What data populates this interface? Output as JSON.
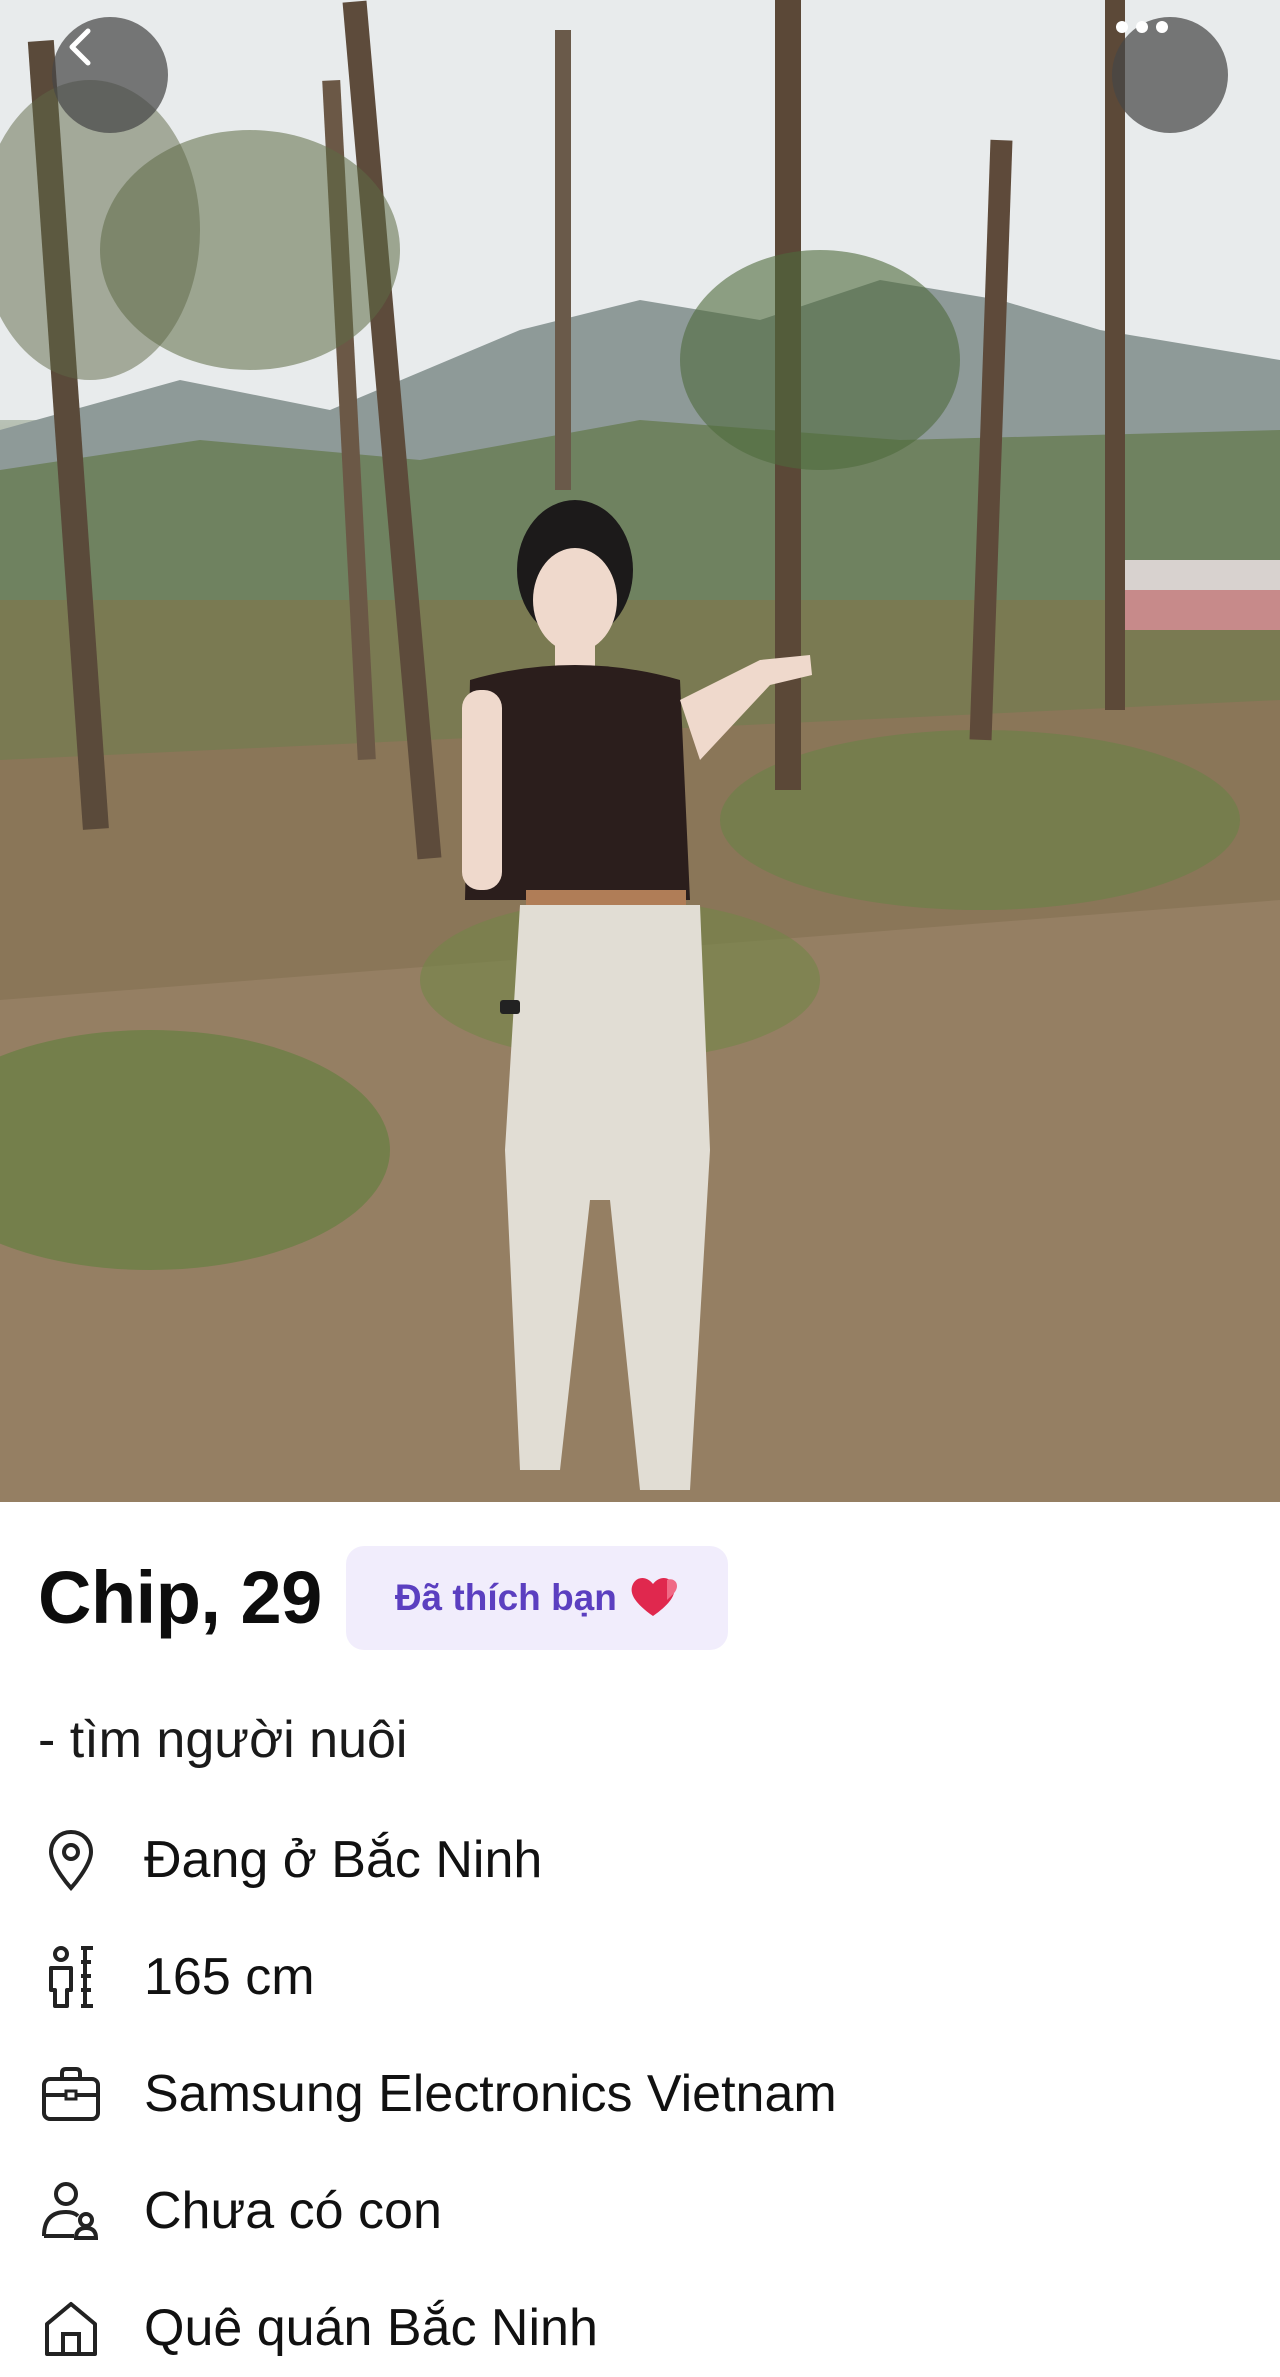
{
  "profile": {
    "name_age": "Chip, 29",
    "liked_badge": "Đã thích bạn",
    "bio": "- tìm người nuôi",
    "details": [
      {
        "icon": "location-pin-icon",
        "text": "Đang ở Bắc Ninh"
      },
      {
        "icon": "height-ruler-icon",
        "text": "165 cm"
      },
      {
        "icon": "briefcase-icon",
        "text": "Samsung Electronics Vietnam"
      },
      {
        "icon": "family-children-icon",
        "text": "Chưa có con"
      },
      {
        "icon": "home-icon",
        "text": "Quê quán Bắc Ninh"
      }
    ]
  },
  "toolbar": {
    "back_icon": "chevron-left-icon",
    "more_icon": "more-dots-icon"
  },
  "colors": {
    "badge_bg": "#f1edfc",
    "badge_text": "#5b3fc0",
    "heart": "#e0284e"
  }
}
